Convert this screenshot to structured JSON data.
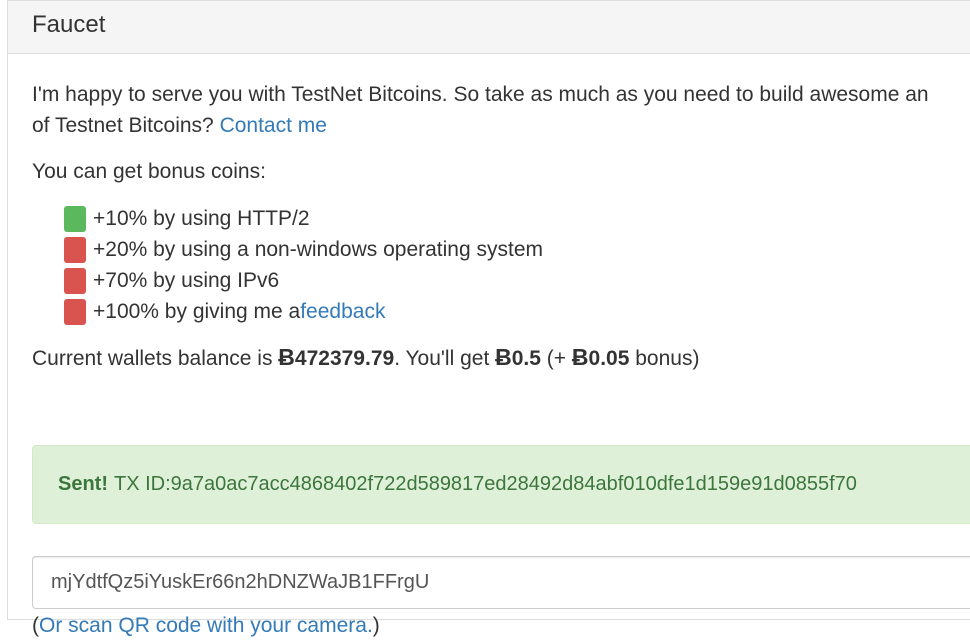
{
  "panel": {
    "title": "Faucet"
  },
  "intro": {
    "line1": "I'm happy to serve you with TestNet Bitcoins. So take as much as you need to build awesome an",
    "line2_prefix": "of Testnet Bitcoins? ",
    "contact_link": "Contact me"
  },
  "bonus": {
    "title": "You can get bonus coins:",
    "items": [
      {
        "status": "ok",
        "text": "+10% by using HTTP/2",
        "link": ""
      },
      {
        "status": "no",
        "text": "+20% by using a non-windows operating system",
        "link": ""
      },
      {
        "status": "no",
        "text": "+70% by using IPv6",
        "link": ""
      },
      {
        "status": "no",
        "text": "+100% by giving me a ",
        "link": "feedback"
      }
    ]
  },
  "balance": {
    "prefix": "Current wallets balance is ",
    "symbol": "Ƀ",
    "amount": "472379.79",
    "middle": ". You'll get ",
    "payout": "0.5",
    "open": " (+ ",
    "bonus": "0.05",
    "suffix": " bonus)"
  },
  "alert": {
    "status": "Sent!",
    "tx_label": "TX ID: ",
    "tx_id": "9a7a0ac7acc4868402f722d589817ed28492d84abf010dfe1d159e91d0855f70"
  },
  "address": {
    "value": "mjYdtfQz5iYuskEr66n2hDNZWaJB1FFrgU"
  },
  "qr": {
    "open": "(",
    "link": "Or scan QR code with your camera.",
    "close": ")"
  },
  "colors": {
    "ok": "#5cb85c",
    "no": "#d9534f",
    "link": "#337ab7",
    "success_bg": "#dff0d8",
    "success_text": "#3c763d"
  }
}
